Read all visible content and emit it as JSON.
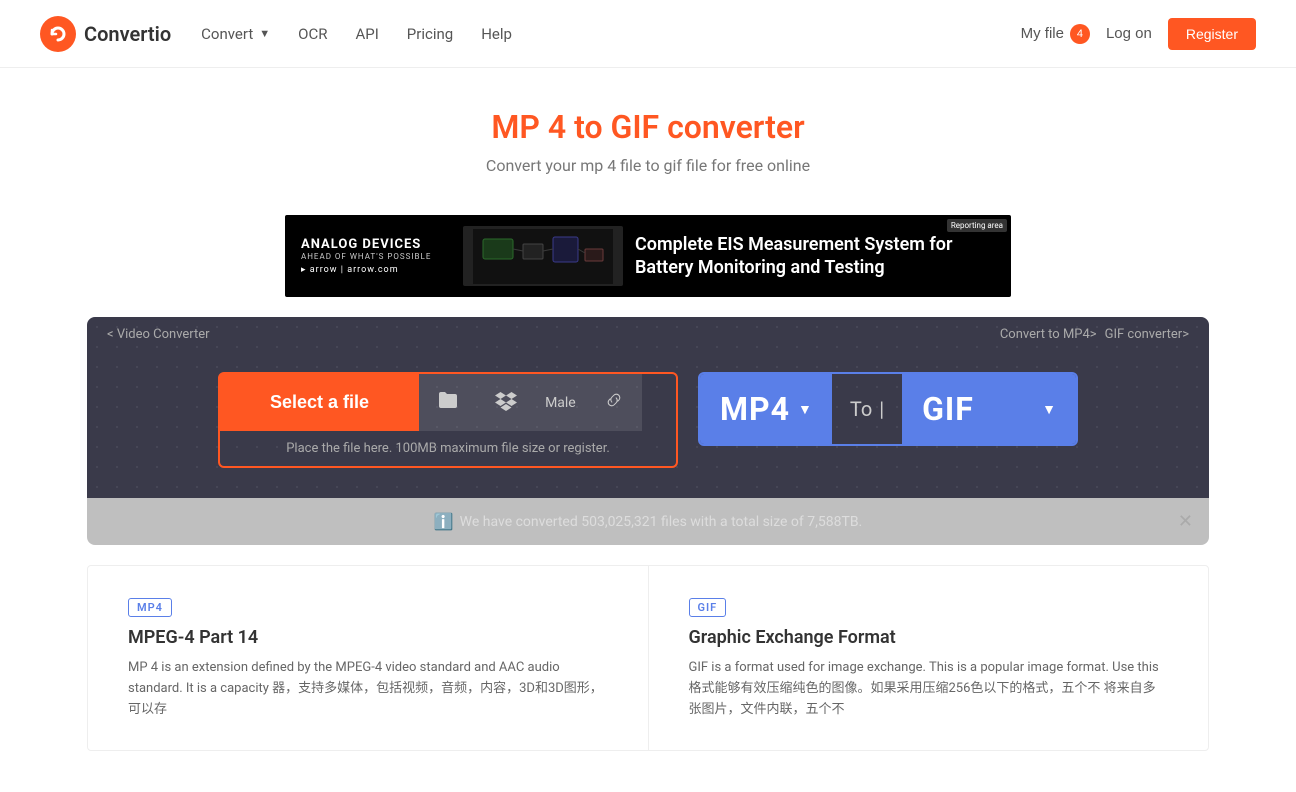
{
  "header": {
    "logo_text": "Convertio",
    "nav": {
      "convert_label": "Convert",
      "ocr_label": "OCR",
      "api_label": "API",
      "pricing_label": "Pricing",
      "help_label": "Help"
    },
    "my_file_label": "My file",
    "file_count": "4",
    "login_label": "Log on",
    "register_label": "Register"
  },
  "hero": {
    "title": "MP 4 to GIF converter",
    "subtitle": "Convert your mp 4 file to gif file for free online"
  },
  "ad": {
    "brand": "ANALOG DEVICES",
    "tagline": "AHEAD OF WHAT'S POSSIBLE",
    "arrow": "▸ arrow | arrow.com",
    "text": "Complete EIS Measurement System for Battery Monitoring and Testing",
    "corner": "Reporting area"
  },
  "breadcrumb": {
    "left": "< Video Converter",
    "right1": "Convert to MP4>",
    "right2": "GIF converter>"
  },
  "converter": {
    "select_file_label": "Select a file",
    "file_name": "Male",
    "file_hint": "Place the file here. 100MB maximum file size or register.",
    "register_link": "register",
    "format_from": "MP4",
    "format_to_text": "To",
    "format_to": "GIF"
  },
  "notification": {
    "text": "We have converted 503,025,321 files with a total size of 7,588TB.",
    "icon": "ℹ"
  },
  "info": {
    "mp4": {
      "badge": "MP4",
      "title": "MPEG-4 Part 14",
      "text": "MP 4 is an extension defined by the MPEG-4 video standard and AAC audio standard. It is a capacity 器，支持多媒体，包括视频，音频，内容，3D和3D图形，可以存"
    },
    "gif": {
      "badge": "GIF",
      "title": "Graphic Exchange Format",
      "text": "GIF is a format used for image exchange. This is a popular image format. Use this 格式能够有效压缩纯色的图像。如果采用压缩256色以下的格式，五个不 将来自多张图片，文件内联，五个不"
    }
  }
}
